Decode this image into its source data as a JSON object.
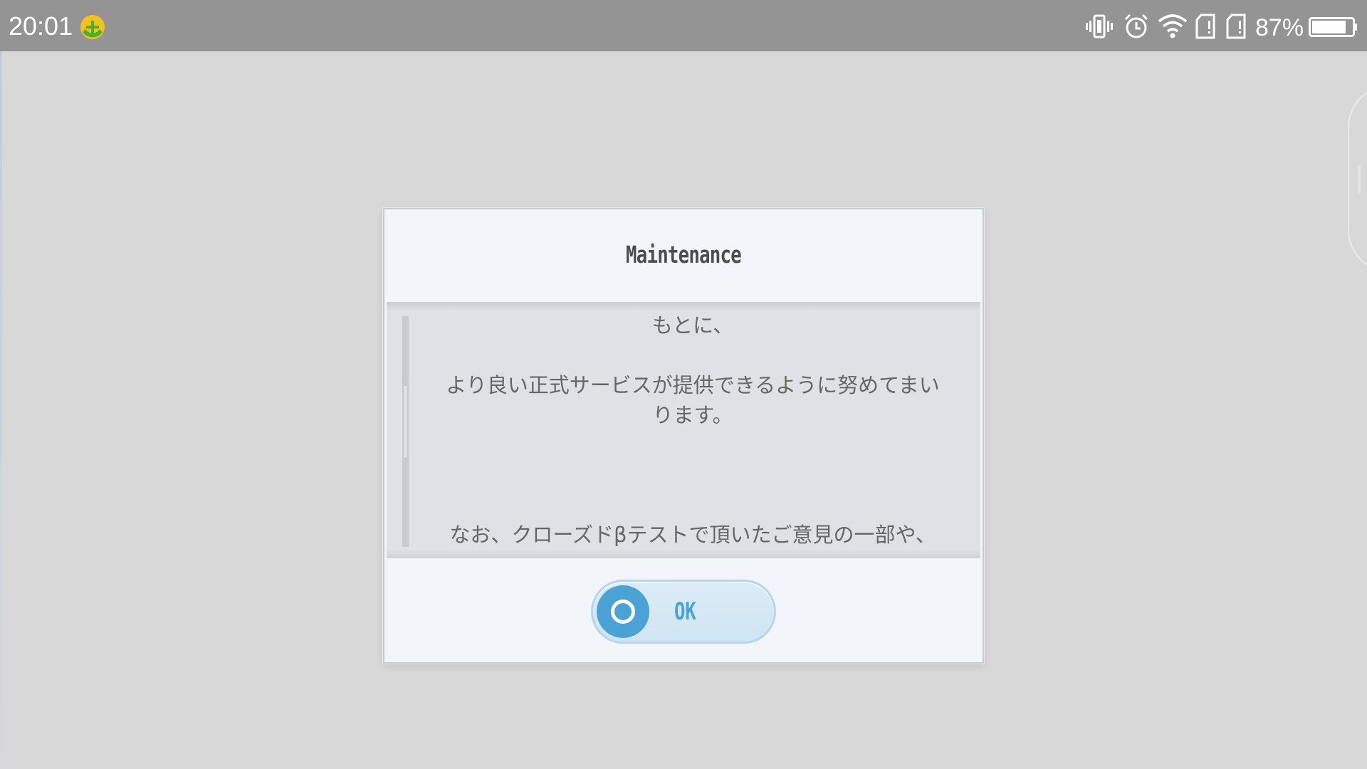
{
  "status_bar": {
    "time": "20:01",
    "app_icon": "green-plus-badge-icon",
    "icons": [
      "vibrate-icon",
      "alarm-icon",
      "wifi-icon",
      "sim-card-1-icon",
      "sim-card-2-icon",
      "battery-icon"
    ],
    "battery_percent": "87%",
    "battery_level": 0.87
  },
  "dialog": {
    "title": "Maintenance",
    "body_lines": [
      "もとに、",
      "より良い正式サービスが提供できるように努めてまい",
      "ります。",
      "なお、クローズドβテストで頂いたご意見の一部や、"
    ],
    "ok_button": {
      "label": "OK",
      "icon": "circle-button-icon"
    }
  },
  "colors": {
    "status_bar_bg": "#949494",
    "screen_bg": "#d8d8d8",
    "dialog_bg": "#f2f5fa",
    "body_bg": "#dfe1e4",
    "accent": "#4aa3d4"
  }
}
